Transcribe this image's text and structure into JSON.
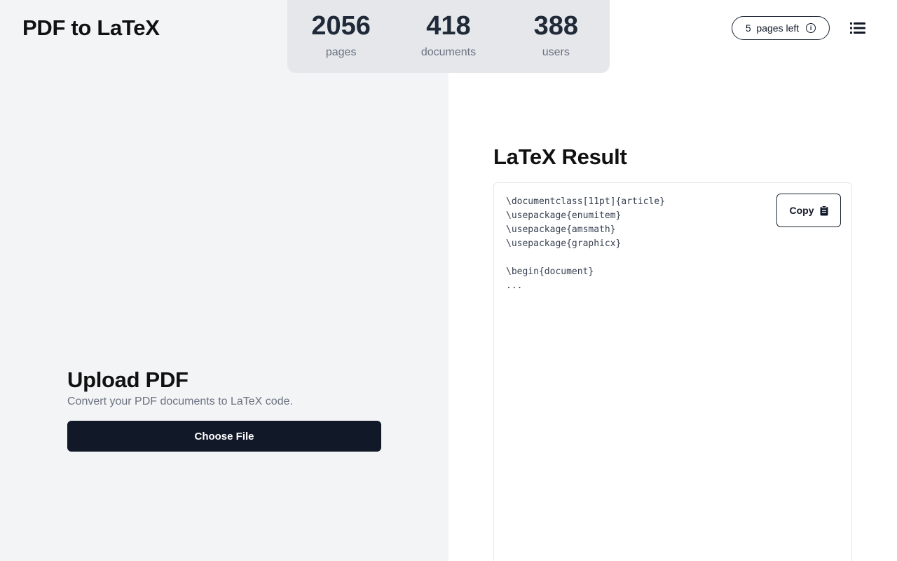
{
  "header": {
    "app_title": "PDF to LaTeX",
    "pages_left": "5  pages left",
    "info_icon": "info-icon",
    "menu_icon": "list-menu-icon"
  },
  "stats": [
    {
      "value": "2056",
      "label": "pages"
    },
    {
      "value": "418",
      "label": "documents"
    },
    {
      "value": "388",
      "label": "users"
    }
  ],
  "upload": {
    "title": "Upload PDF",
    "subtitle": "Convert your PDF documents to LaTeX code.",
    "button_label": "Choose File"
  },
  "result": {
    "title": "LaTeX Result",
    "code": "\\documentclass[11pt]{article}\n\\usepackage{enumitem}\n\\usepackage{amsmath}\n\\usepackage{graphicx}\n\n\\begin{document}\n...",
    "copy_label": "Copy",
    "copy_icon": "clipboard-icon"
  },
  "colors": {
    "left_bg": "#f3f4f6",
    "stats_bg": "#e5e7eb",
    "button_bg": "#111827",
    "text_muted": "#6b7280"
  }
}
